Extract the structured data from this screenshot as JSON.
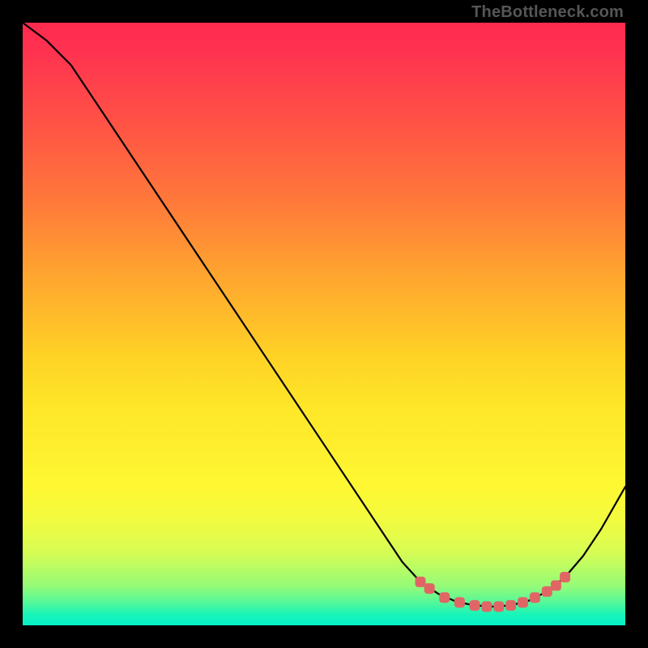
{
  "attribution": "TheBottleneck.com",
  "chart_data": {
    "type": "line",
    "title": "",
    "xlabel": "",
    "ylabel": "",
    "xlim": [
      0,
      100
    ],
    "ylim": [
      0,
      100
    ],
    "curve": [
      {
        "x": 0,
        "y": 100
      },
      {
        "x": 4,
        "y": 97
      },
      {
        "x": 8,
        "y": 93
      },
      {
        "x": 12,
        "y": 87
      },
      {
        "x": 20,
        "y": 75
      },
      {
        "x": 30,
        "y": 60
      },
      {
        "x": 40,
        "y": 45
      },
      {
        "x": 50,
        "y": 30
      },
      {
        "x": 58,
        "y": 18
      },
      {
        "x": 63,
        "y": 10.5
      },
      {
        "x": 66,
        "y": 7.2
      },
      {
        "x": 69,
        "y": 5.2
      },
      {
        "x": 72,
        "y": 3.9
      },
      {
        "x": 75,
        "y": 3.3
      },
      {
        "x": 78,
        "y": 3.1
      },
      {
        "x": 81,
        "y": 3.3
      },
      {
        "x": 84,
        "y": 4.1
      },
      {
        "x": 87,
        "y": 5.6
      },
      {
        "x": 90,
        "y": 8.0
      },
      {
        "x": 93,
        "y": 11.5
      },
      {
        "x": 96,
        "y": 16.0
      },
      {
        "x": 100,
        "y": 23.0
      }
    ],
    "markers": [
      {
        "x": 66,
        "y": 7.2
      },
      {
        "x": 67.5,
        "y": 6.1
      },
      {
        "x": 70,
        "y": 4.6
      },
      {
        "x": 72.5,
        "y": 3.8
      },
      {
        "x": 75,
        "y": 3.3
      },
      {
        "x": 77,
        "y": 3.1
      },
      {
        "x": 79,
        "y": 3.1
      },
      {
        "x": 81,
        "y": 3.3
      },
      {
        "x": 83,
        "y": 3.8
      },
      {
        "x": 85,
        "y": 4.6
      },
      {
        "x": 87,
        "y": 5.6
      },
      {
        "x": 88.5,
        "y": 6.6
      },
      {
        "x": 90,
        "y": 8.0
      }
    ]
  }
}
